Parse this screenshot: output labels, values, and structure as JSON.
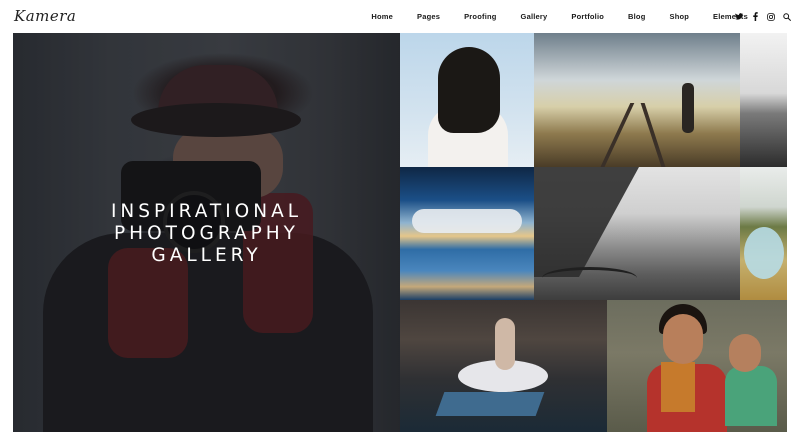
{
  "brand": {
    "logo_text": "Kamera"
  },
  "nav": {
    "items": [
      {
        "label": "Home"
      },
      {
        "label": "Pages"
      },
      {
        "label": "Proofing"
      },
      {
        "label": "Gallery"
      },
      {
        "label": "Portfolio"
      },
      {
        "label": "Blog"
      },
      {
        "label": "Shop"
      },
      {
        "label": "Elements"
      }
    ]
  },
  "social": {
    "icons": [
      "twitter-icon",
      "facebook-icon",
      "instagram-icon",
      "search-icon"
    ]
  },
  "hero": {
    "line1": "INSPIRATIONAL",
    "line2": "PHOTOGRAPHY",
    "line3": "GALLERY"
  },
  "colors": {
    "nav_text": "#1a1a1a",
    "hero_text": "#ffffff",
    "background": "#ffffff"
  }
}
